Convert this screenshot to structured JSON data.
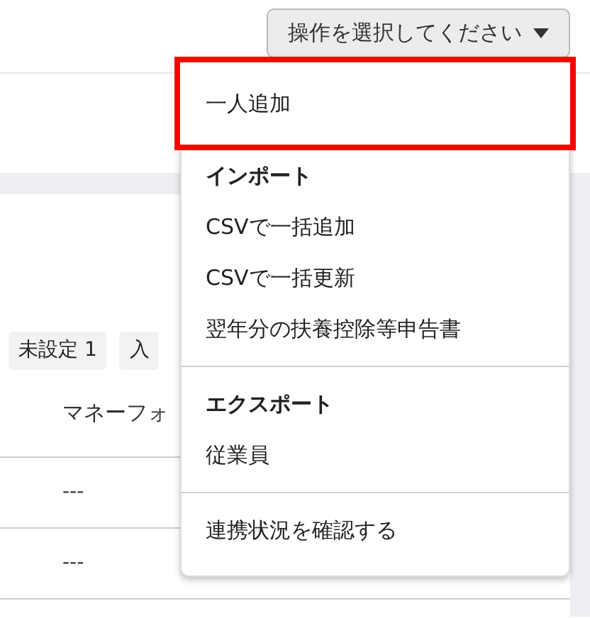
{
  "action_button": {
    "label": "操作を選択してください"
  },
  "tags": [
    {
      "label": "未設定 1"
    },
    {
      "label": "入"
    }
  ],
  "table": {
    "columns": [
      "マネーフォ"
    ],
    "rows": [
      [
        "---"
      ],
      [
        "---"
      ]
    ]
  },
  "menu": {
    "items": [
      {
        "kind": "item",
        "label": "一人追加",
        "selected": true
      },
      {
        "kind": "header",
        "label": "インポート"
      },
      {
        "kind": "item",
        "label": "CSVで一括追加",
        "selected": false
      },
      {
        "kind": "item",
        "label": "CSVで一括更新",
        "selected": false
      },
      {
        "kind": "item",
        "label": "翌年分の扶養控除等申告書",
        "selected": false
      },
      {
        "kind": "divider"
      },
      {
        "kind": "header",
        "label": "エクスポート"
      },
      {
        "kind": "item",
        "label": "従業員",
        "selected": false
      },
      {
        "kind": "divider"
      },
      {
        "kind": "item",
        "label": "連携状況を確認する",
        "selected": false
      }
    ]
  }
}
